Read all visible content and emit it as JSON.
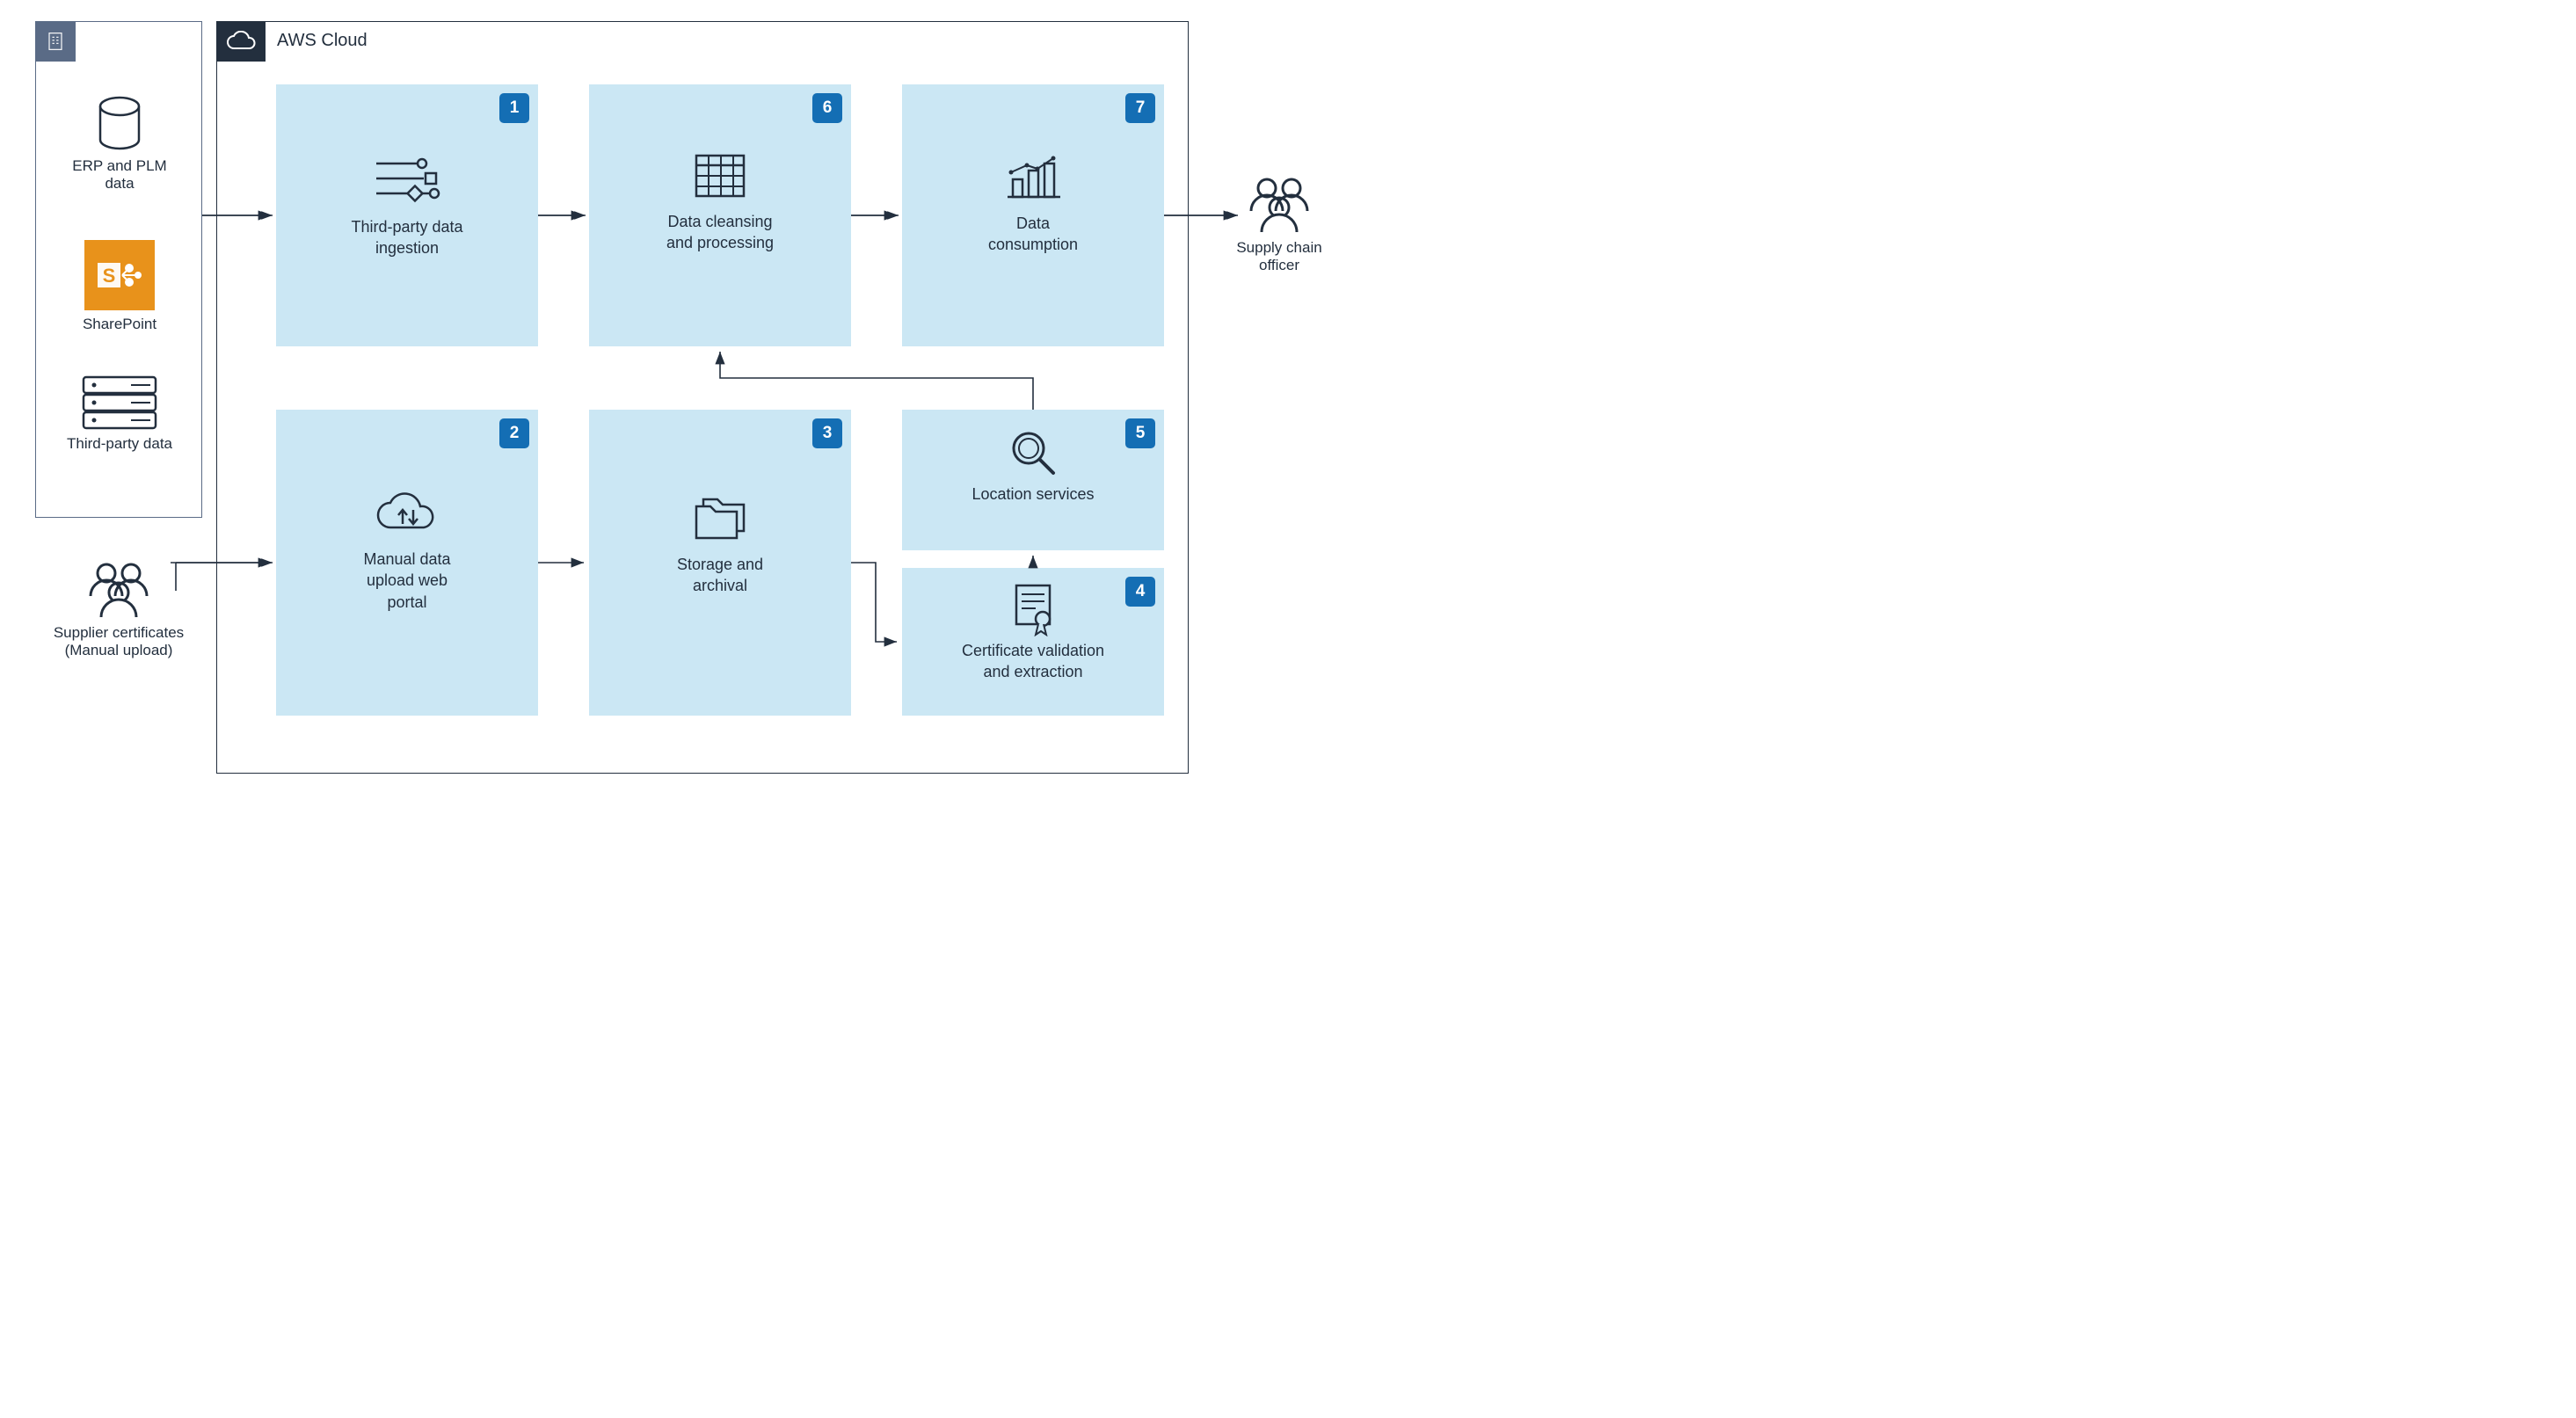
{
  "aws_cloud_label": "AWS Cloud",
  "onprem": {
    "erp_label": "ERP and PLM data",
    "sharepoint_label": "SharePoint",
    "thirdparty_label": "Third-party data"
  },
  "supplier_label_line1": "Supplier certificates",
  "supplier_label_line2": "(Manual upload)",
  "officer_label_line1": "Supply chain",
  "officer_label_line2": "officer",
  "steps": {
    "1": {
      "num": "1",
      "line1": "Third-party data",
      "line2": "ingestion"
    },
    "2": {
      "num": "2",
      "line1": "Manual data",
      "line2": "upload web",
      "line3": "portal"
    },
    "3": {
      "num": "3",
      "line1": "Storage and",
      "line2": "archival"
    },
    "4": {
      "num": "4",
      "line1": "Certificate validation",
      "line2": "and extraction"
    },
    "5": {
      "num": "5",
      "line1": "Location services"
    },
    "6": {
      "num": "6",
      "line1": "Data cleansing",
      "line2": "and processing"
    },
    "7": {
      "num": "7",
      "line1": "Data",
      "line2": "consumption"
    }
  },
  "colors": {
    "step_bg": "#cbe7f4",
    "badge_bg": "#146eb4",
    "aws_dark": "#232f3e",
    "onprem_border": "#5a6b86",
    "sharepoint": "#e8921b"
  }
}
